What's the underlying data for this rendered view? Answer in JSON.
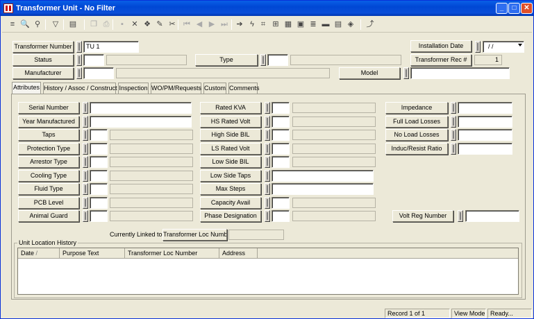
{
  "window": {
    "title": "Transformer Unit - No Filter",
    "min": "_",
    "max": "□",
    "close": "✕"
  },
  "toolbar": {
    "icons": [
      "list-icon",
      "find-icon",
      "binoculars-icon",
      "filter-icon",
      "form-icon",
      "copy-icon",
      "print-icon",
      "save-icon",
      "delete-icon",
      "stamp-icon",
      "pencil-icon",
      "scissors-icon",
      "first-icon",
      "prev-icon",
      "next-icon",
      "last-icon",
      "go-icon",
      "lightning-icon",
      "map-icon",
      "tree-icon",
      "chart-icon",
      "calc-icon",
      "layers-icon",
      "truck-icon",
      "book-icon",
      "help-icon",
      "exit-icon"
    ],
    "glyphs": [
      "≡",
      "🔍",
      "⚲",
      "▽",
      "▤",
      "❐",
      "⎙",
      "▪",
      "✕",
      "❖",
      "✎",
      "✂",
      "⏮",
      "◀",
      "▶",
      "⏭",
      "➔",
      "ϟ",
      "⌗",
      "⊞",
      "▦",
      "▣",
      "≣",
      "▬",
      "▤",
      "◈",
      "⤴"
    ]
  },
  "header": {
    "transformer_number_label": "Transformer Number",
    "transformer_number_value": "TU 1",
    "status_label": "Status",
    "type_label": "Type",
    "manufacturer_label": "Manufacturer",
    "model_label": "Model",
    "installation_date_label": "Installation Date",
    "installation_date_value": "/ /",
    "transformer_rec_label": "Transformer Rec #",
    "transformer_rec_value": "1"
  },
  "tabs": [
    "Attributes",
    "History / Assoc / Construct",
    "Inspection",
    "WO/PM/Requests",
    "Custom",
    "Comments"
  ],
  "attributes": {
    "col1": [
      "Serial Number",
      "Year Manufactured",
      "Taps",
      "Protection Type",
      "Arrestor Type",
      "Cooling Type",
      "Fluid Type",
      "PCB Level",
      "Animal Guard"
    ],
    "col2": [
      "Rated KVA",
      "HS Rated Volt",
      "High Side BIL",
      "LS Rated Volt",
      "Low Side BIL",
      "Low Side Taps",
      "Max Steps",
      "Capacity Avail",
      "Phase Designation"
    ],
    "col3": [
      "Impedance",
      "Full Load Losses",
      "No Load Losses",
      "Induc/Resist Ratio"
    ],
    "volt_reg_label": "Volt Reg Number",
    "currently_linked_label": "Currently Linked to",
    "transformer_loc_label": "Transformer Loc Number"
  },
  "location_history": {
    "title": "Unit Location History",
    "columns": [
      "Date",
      "Purpose Text",
      "Transformer Loc Number",
      "Address"
    ],
    "sort_indicator": "/"
  },
  "statusbar": {
    "record": "Record 1 of 1",
    "mode": "View Mode",
    "state": "Ready..."
  }
}
